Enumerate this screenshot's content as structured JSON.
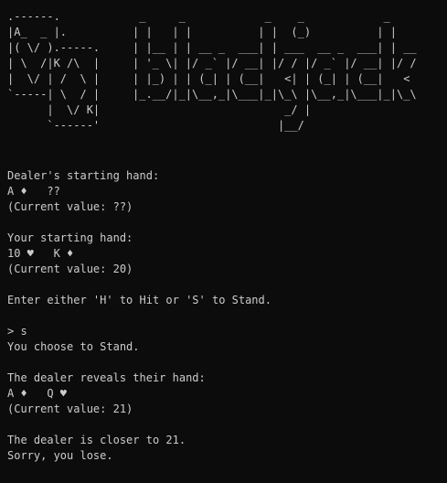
{
  "banner": {
    "cards_art": ".------.\n|A_  _ |.\n|( \\/ ).-----.\n| \\  /|K /\\  |\n|  \\/ | /  \\ |\n`-----| \\  / |\n      |  \\/ K|\n      `------'",
    "logo_art": " _     _            _    _            _   \n| |   | |          | |  (_)          | |  \n| |__ | | __ _  ___| | ___  __ _  ___| | __\n| '_ \\| |/ _` |/ __| |/ / |/ _` |/ __| |/ /\n| |_) | | (_| | (__|   <| | (_| | (__|   < \n|_.__/|_|\\__,_|\\___|_|\\_\\ |\\__,_|\\___|_|\\_\\\n                       _/ |                \n                      |__/                 "
  },
  "log": {
    "dealer_start_heading": "Dealer's starting hand:",
    "dealer_start_cards": "A ♦   ??",
    "dealer_start_value": "(Current value: ??)",
    "player_start_heading": "Your starting hand:",
    "player_start_cards": "10 ♥   K ♦",
    "player_start_value": "(Current value: 20)",
    "prompt_instruction": "Enter either 'H' to Hit or 'S' to Stand.",
    "user_input": "> s",
    "choice_message": "You choose to Stand.",
    "dealer_reveal_heading": "The dealer reveals their hand:",
    "dealer_reveal_cards": "A ♦   Q ♥",
    "dealer_reveal_value": "(Current value: 21)",
    "result_line1": "The dealer is closer to 21.",
    "result_line2": "Sorry, you lose."
  },
  "colors": {
    "background": "#0c0c0c",
    "foreground": "#cccccc"
  }
}
